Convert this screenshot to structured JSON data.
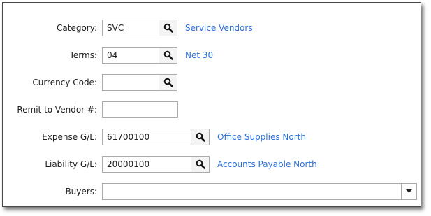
{
  "form": {
    "category": {
      "label": "Category:",
      "value": "SVC",
      "description": "Service Vendors",
      "lookup_icon": "search-icon"
    },
    "terms": {
      "label": "Terms:",
      "value": "04",
      "description": "Net 30",
      "lookup_icon": "search-icon"
    },
    "currency_code": {
      "label": "Currency Code:",
      "value": "",
      "lookup_icon": "search-icon"
    },
    "remit_to_vendor": {
      "label": "Remit to Vendor #:",
      "value": ""
    },
    "expense_gl": {
      "label": "Expense G/L:",
      "value": "61700100",
      "description": "Office Supplies North",
      "lookup_icon": "search-icon"
    },
    "liability_gl": {
      "label": "Liability G/L:",
      "value": "20000100",
      "description": "Accounts Payable North",
      "lookup_icon": "search-icon"
    },
    "buyers": {
      "label": "Buyers:",
      "value": "",
      "dropdown_icon": "chevron-down-icon"
    }
  },
  "colors": {
    "link": "#2a6fd6",
    "border": "#ababab",
    "panel_border": "#4a4a4a"
  }
}
